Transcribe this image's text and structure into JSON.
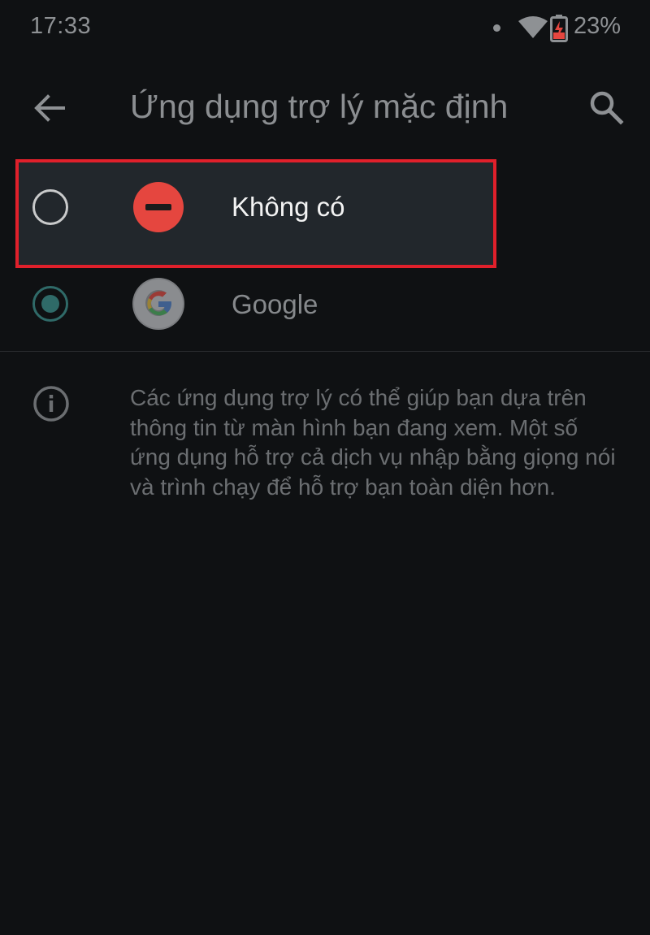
{
  "status_bar": {
    "time": "17:33",
    "battery_percent": "23%",
    "icons": [
      "notification-dot",
      "wifi-icon",
      "battery-charging-icon"
    ]
  },
  "app_bar": {
    "title": "Ứng dụng trợ lý mặc định",
    "back_icon": "arrow-left-icon",
    "search_icon": "search-icon"
  },
  "options": [
    {
      "label": "Không có",
      "selected": false,
      "icon": "minus-circle-icon",
      "highlighted": true
    },
    {
      "label": "Google",
      "selected": true,
      "icon": "google-g-icon",
      "highlighted": false
    }
  ],
  "info": {
    "icon": "info-icon",
    "text": "Các ứng dụng trợ lý có thể giúp bạn dựa trên thông tin từ màn hình bạn đang xem. Một số ứng dụng hỗ trợ cả dịch vụ nhập bằng giọng nói và trình chạy để hỗ trợ bạn toàn diện hơn."
  },
  "colors": {
    "background": "#0f1113",
    "highlight_border": "#e0202b",
    "highlight_fill": "#22272c",
    "radio_selected": "#2f6a68",
    "none_icon": "#e5463f"
  }
}
